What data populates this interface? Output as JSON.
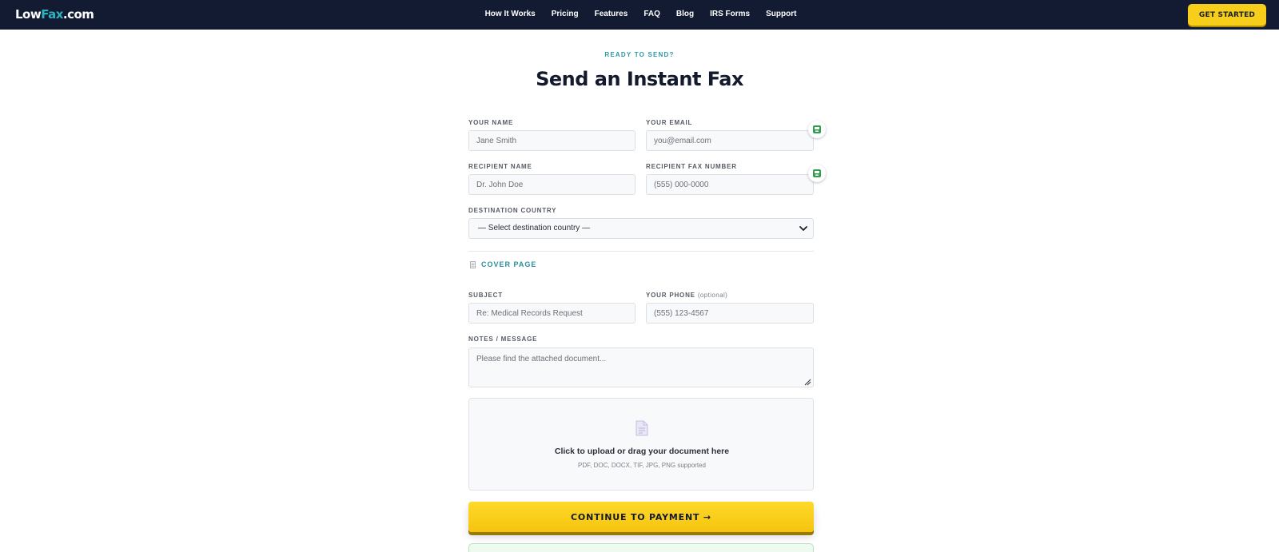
{
  "header": {
    "logo_part1": "Low",
    "logo_part2": "Fax",
    "logo_part3": ".com",
    "nav": [
      "How It Works",
      "Pricing",
      "Features",
      "FAQ",
      "Blog",
      "IRS Forms",
      "Support"
    ],
    "cta_label": "GET STARTED"
  },
  "hero": {
    "eyebrow": "READY TO SEND?",
    "title": "Send an Instant Fax"
  },
  "form": {
    "your_name": {
      "label": "YOUR NAME",
      "placeholder": "Jane Smith",
      "value": ""
    },
    "your_email": {
      "label": "YOUR EMAIL",
      "placeholder": "you@email.com",
      "value": ""
    },
    "recipient_name": {
      "label": "RECIPIENT NAME",
      "placeholder": "Dr. John Doe",
      "value": ""
    },
    "recipient_fax": {
      "label": "RECIPIENT FAX NUMBER",
      "placeholder": "(555) 000-0000",
      "value": ""
    },
    "destination_country": {
      "label": "DESTINATION COUNTRY",
      "selected": "— Select destination country —"
    },
    "cover_page_label": "COVER PAGE",
    "subject": {
      "label": "SUBJECT",
      "placeholder": "Re: Medical Records Request",
      "value": ""
    },
    "your_phone": {
      "label": "YOUR PHONE",
      "optional": "(optional)",
      "placeholder": "(555) 123-4567",
      "value": ""
    },
    "notes": {
      "label": "NOTES / MESSAGE",
      "placeholder": "Please find the attached document...",
      "value": ""
    },
    "upload": {
      "title": "Click to upload or drag your document here",
      "subtitle": "PDF, DOC, DOCX, TIF, JPG, PNG supported"
    },
    "submit_label": "CONTINUE TO PAYMENT →"
  },
  "colors": {
    "nav_bg": "#131b33",
    "accent_teal": "#2bb3c0",
    "cta_yellow": "#f7cf1a",
    "heading": "#141a2e"
  },
  "icons": {
    "helper": "password-manager-icon",
    "chevron": "chevron-down-icon",
    "cover": "document-icon",
    "upload": "document-upload-icon"
  }
}
